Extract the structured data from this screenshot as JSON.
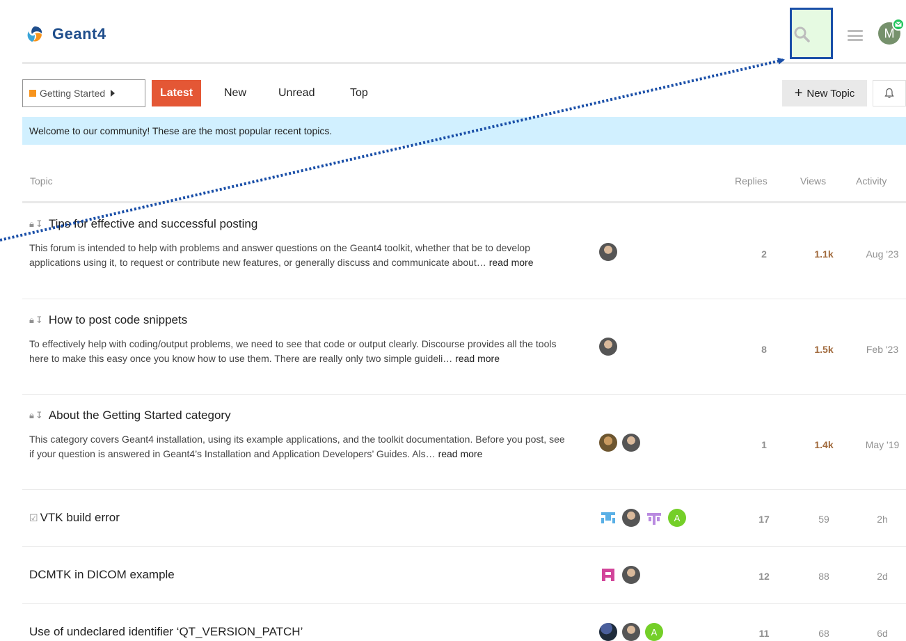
{
  "header": {
    "logo_text": "Geant4",
    "avatar_letter": "M"
  },
  "nav": {
    "category_label": "Getting Started",
    "tabs": [
      {
        "label": "Latest",
        "active": true
      },
      {
        "label": "New",
        "active": false
      },
      {
        "label": "Unread",
        "active": false
      },
      {
        "label": "Top",
        "active": false
      }
    ],
    "new_topic_label": "New Topic"
  },
  "banner": {
    "text": "Welcome to our community! These are the most popular recent topics."
  },
  "table": {
    "columns": {
      "topic": "Topic",
      "replies": "Replies",
      "views": "Views",
      "activity": "Activity"
    },
    "rows": [
      {
        "title": "Tips for effective and successful posting",
        "excerpt": "This forum is intended to help with problems and answer questions on the Geant4 toolkit, whether that be to develop applications using it, to request or contribute new features, or generally discuss and communicate about…",
        "read_more": "read more",
        "replies": "2",
        "views": "1.1k",
        "activity": "Aug '23"
      },
      {
        "title": "How to post code snippets",
        "excerpt": "To effectively help with coding/output problems, we need to see that code or output clearly. Discourse provides all the tools here to make this easy once you know how to use them. There are really only two simple guideli…",
        "read_more": "read more",
        "replies": "8",
        "views": "1.5k",
        "activity": "Feb '23"
      },
      {
        "title": "About the Getting Started category",
        "excerpt": "This category covers Geant4 installation, using its example applications, and the toolkit documentation. Before you post, see if your question is answered in Geant4’s Installation and Application Developers’ Guides. Als…",
        "read_more": "read more",
        "replies": "1",
        "views": "1.4k",
        "activity": "May '19"
      },
      {
        "title": "VTK build error",
        "replies": "17",
        "views": "59",
        "activity": "2h",
        "avatar_letter": "A"
      },
      {
        "title": "DCMTK in DICOM example",
        "replies": "12",
        "views": "88",
        "activity": "2d"
      },
      {
        "title": "Use of undeclared identifier ‘QT_VERSION_PATCH’",
        "replies": "11",
        "views": "68",
        "activity": "6d",
        "avatar_letter": "A"
      }
    ]
  },
  "colors": {
    "latest_tab": "#e45735",
    "category_swatch": "#f7941d",
    "banner_bg": "#d1f0ff",
    "hot_views": "#a16a3d",
    "highlight_border": "#1a4fa8"
  },
  "icons": [
    "geant4-logo-icon",
    "search-icon",
    "hamburger-menu-icon",
    "mail-badge-icon",
    "caret-right-icon",
    "plus-icon",
    "bell-icon",
    "lock-icon",
    "pin-icon",
    "solved-checkbox-icon"
  ]
}
